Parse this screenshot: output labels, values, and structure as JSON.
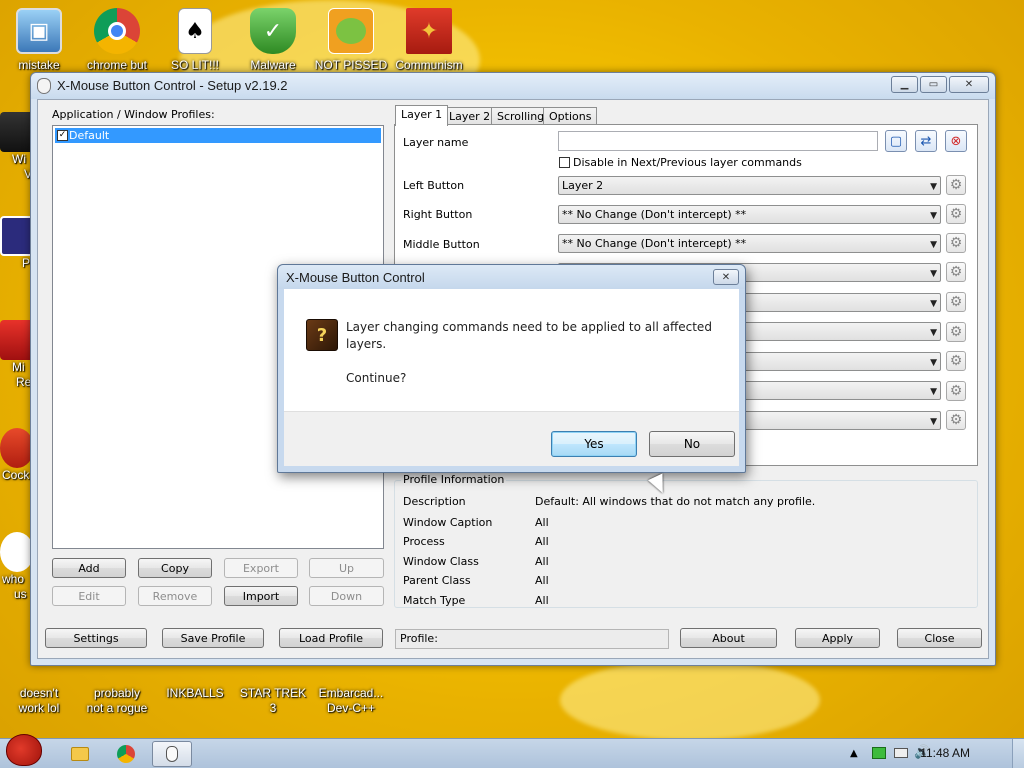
{
  "desktop": {
    "icons_top": [
      {
        "label": "mistake"
      },
      {
        "label": "chrome but"
      },
      {
        "label": "SO LIT!!!"
      },
      {
        "label": "Malware"
      },
      {
        "label": "NOT PISSED"
      },
      {
        "label": "Communism"
      }
    ],
    "icons_left": [
      {
        "label": "Wi"
      },
      {
        "label": "V"
      },
      {
        "label": "P"
      },
      {
        "label": "Mi"
      },
      {
        "label": "Re"
      },
      {
        "label": "Cock"
      },
      {
        "label": "who"
      },
      {
        "label": "us"
      }
    ],
    "icons_bottom": [
      {
        "label1": "doesn't",
        "label2": "work lol"
      },
      {
        "label1": "probably",
        "label2": "not a rogue"
      },
      {
        "label1": "INKBALLS",
        "label2": ""
      },
      {
        "label1": "STAR TREK",
        "label2": "3"
      },
      {
        "label1": "Embarcad...",
        "label2": "Dev-C++"
      }
    ]
  },
  "main_window": {
    "title": "X-Mouse Button Control - Setup v2.19.2",
    "profiles_label": "Application / Window Profiles:",
    "profile_default": "Default",
    "buttons": {
      "add": "Add",
      "copy": "Copy",
      "export": "Export",
      "up": "Up",
      "edit": "Edit",
      "remove": "Remove",
      "import": "Import",
      "down": "Down"
    },
    "tabs": [
      "Layer 1",
      "Layer 2",
      "Scrolling",
      "Options"
    ],
    "layer_name_label": "Layer name",
    "disable_label": "Disable in Next/Previous layer commands",
    "rows": [
      {
        "label": "Left Button",
        "value": "Layer 2"
      },
      {
        "label": "Right Button",
        "value": "** No Change (Don't intercept) **"
      },
      {
        "label": "Middle Button",
        "value": "** No Change (Don't intercept) **"
      }
    ],
    "profile_info": {
      "title": "Profile Information",
      "rows": [
        {
          "label": "Description",
          "value": "Default: All windows that do not match any profile."
        },
        {
          "label": "Window Caption",
          "value": "All"
        },
        {
          "label": "Process",
          "value": "All"
        },
        {
          "label": "Window Class",
          "value": "All"
        },
        {
          "label": "Parent Class",
          "value": "All"
        },
        {
          "label": "Match Type",
          "value": "All"
        }
      ]
    },
    "bottom": {
      "settings": "Settings",
      "save_profile": "Save Profile",
      "load_profile": "Load Profile",
      "profile_status": "Profile:",
      "about": "About",
      "apply": "Apply",
      "close": "Close"
    }
  },
  "dialog": {
    "title": "X-Mouse Button Control",
    "message_line1": "Layer changing commands need to be applied to all affected",
    "message_line2": "layers.",
    "message_line3": "Continue?",
    "yes": "Yes",
    "no": "No"
  },
  "taskbar": {
    "clock": "11:48 AM"
  }
}
